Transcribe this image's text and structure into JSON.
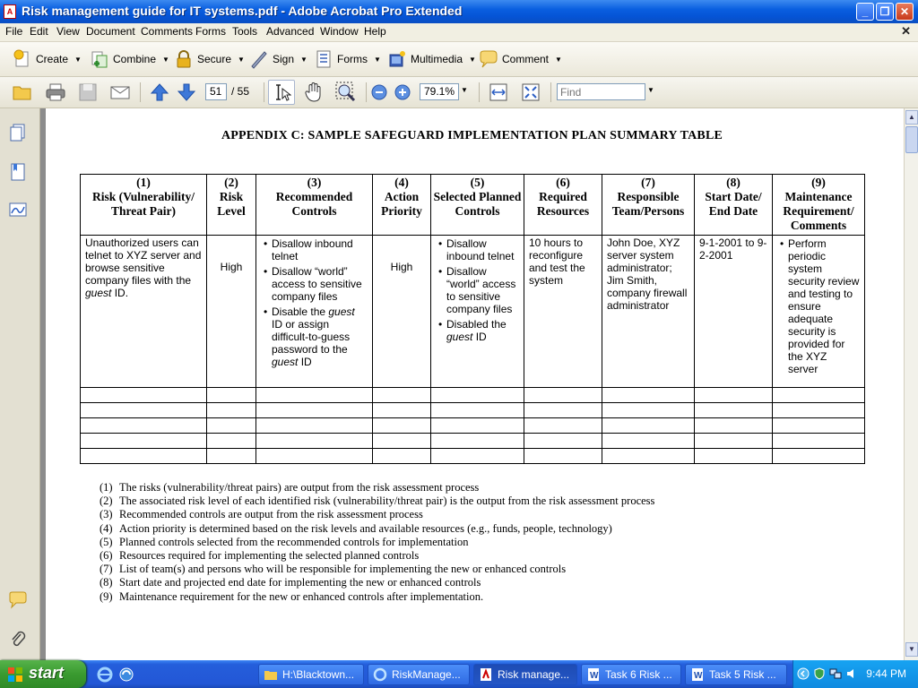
{
  "window": {
    "title": "Risk management guide for IT systems.pdf - Adobe Acrobat Pro Extended",
    "app_icon_text": "A"
  },
  "menu": [
    "File",
    "Edit",
    "View",
    "Document",
    "Comments",
    "Forms",
    "Tools",
    "Advanced",
    "Window",
    "Help"
  ],
  "tasks": [
    {
      "label": "Create",
      "icon": "create-icon"
    },
    {
      "label": "Combine",
      "icon": "combine-icon"
    },
    {
      "label": "Secure",
      "icon": "lock-icon"
    },
    {
      "label": "Sign",
      "icon": "pen-icon"
    },
    {
      "label": "Forms",
      "icon": "forms-icon"
    },
    {
      "label": "Multimedia",
      "icon": "multimedia-icon"
    },
    {
      "label": "Comment",
      "icon": "comment-icon"
    }
  ],
  "nav": {
    "current_page": "51",
    "total_pages": "/ 55",
    "zoom": "79.1%",
    "find_placeholder": "Find"
  },
  "doc": {
    "heading": "APPENDIX C:  SAMPLE SAFEGUARD IMPLEMENTATION PLAN SUMMARY TABLE",
    "columns": [
      {
        "num": "(1)",
        "title": "Risk (Vulnerability/ Threat Pair)"
      },
      {
        "num": "(2)",
        "title": "Risk Level"
      },
      {
        "num": "(3)",
        "title": "Recommended Controls"
      },
      {
        "num": "(4)",
        "title": "Action Priority"
      },
      {
        "num": "(5)",
        "title": "Selected Planned Controls"
      },
      {
        "num": "(6)",
        "title": "Required Resources"
      },
      {
        "num": "(7)",
        "title": "Responsible Team/Persons"
      },
      {
        "num": "(8)",
        "title": "Start Date/ End Date"
      },
      {
        "num": "(9)",
        "title": "Maintenance Requirement/ Comments"
      }
    ],
    "row": {
      "risk_pre": "Unauthorized users can telnet to XYZ server and browse sensitive company files with the ",
      "risk_italic": "guest",
      "risk_post": " ID.",
      "level": "High",
      "rec_1": "Disallow inbound telnet",
      "rec_2": "Disallow “world” access to sensitive company files",
      "rec_3_pre": "Disable the ",
      "rec_3_italic_1": "guest",
      "rec_3_mid": " ID or assign difficult-to-guess password to the ",
      "rec_3_italic_2": "guest",
      "rec_3_post": " ID",
      "priority": "High",
      "sel_1": "Disallow inbound telnet",
      "sel_2": "Disallow “world” access to sensitive company files",
      "sel_3_pre": "Disabled the ",
      "sel_3_italic": "guest",
      "sel_3_post": " ID",
      "resources": "10 hours to reconfigure and test the system",
      "team": "John Doe, XYZ server system administrator; Jim Smith, company firewall administrator",
      "dates": "9-1-2001 to 9-2-2001",
      "maintenance": "Perform periodic system security review and testing to ensure adequate security is provided for the XYZ server"
    },
    "notes": [
      {
        "num": "(1)",
        "text": "The risks (vulnerability/threat pairs) are output from the risk assessment process"
      },
      {
        "num": "(2)",
        "text": "The associated risk level of each identified risk (vulnerability/threat pair) is the output from the risk assessment process"
      },
      {
        "num": "(3)",
        "text": "Recommended controls are output from the risk assessment process"
      },
      {
        "num": "(4)",
        "text": "Action priority is determined based on the risk levels and available resources (e.g., funds, people, technology)"
      },
      {
        "num": "(5)",
        "text": "Planned controls selected from the recommended controls for implementation"
      },
      {
        "num": "(6)",
        "text": "Resources required for implementing the selected planned controls"
      },
      {
        "num": "(7)",
        "text": "List of team(s) and persons who will be responsible for implementing the new or enhanced controls"
      },
      {
        "num": "(8)",
        "text": "Start date and projected end date for implementing the new or enhanced controls"
      },
      {
        "num": "(9)",
        "text": "Maintenance requirement for the new or enhanced controls after implementation."
      }
    ]
  },
  "taskbar": {
    "start": "start",
    "items": [
      {
        "label": "H:\\Blacktown...",
        "icon": "folder-icon"
      },
      {
        "label": "RiskManage...",
        "icon": "ie-icon"
      },
      {
        "label": "Risk manage...",
        "icon": "acrobat-icon"
      },
      {
        "label": "Task 6 Risk ...",
        "icon": "word-icon"
      },
      {
        "label": "Task 5 Risk ...",
        "icon": "word-icon"
      }
    ],
    "clock": "9:44 PM"
  },
  "colors": {
    "titlebar": "#0a5fe0",
    "taskbar": "#245edb",
    "start": "#3a9a30"
  }
}
